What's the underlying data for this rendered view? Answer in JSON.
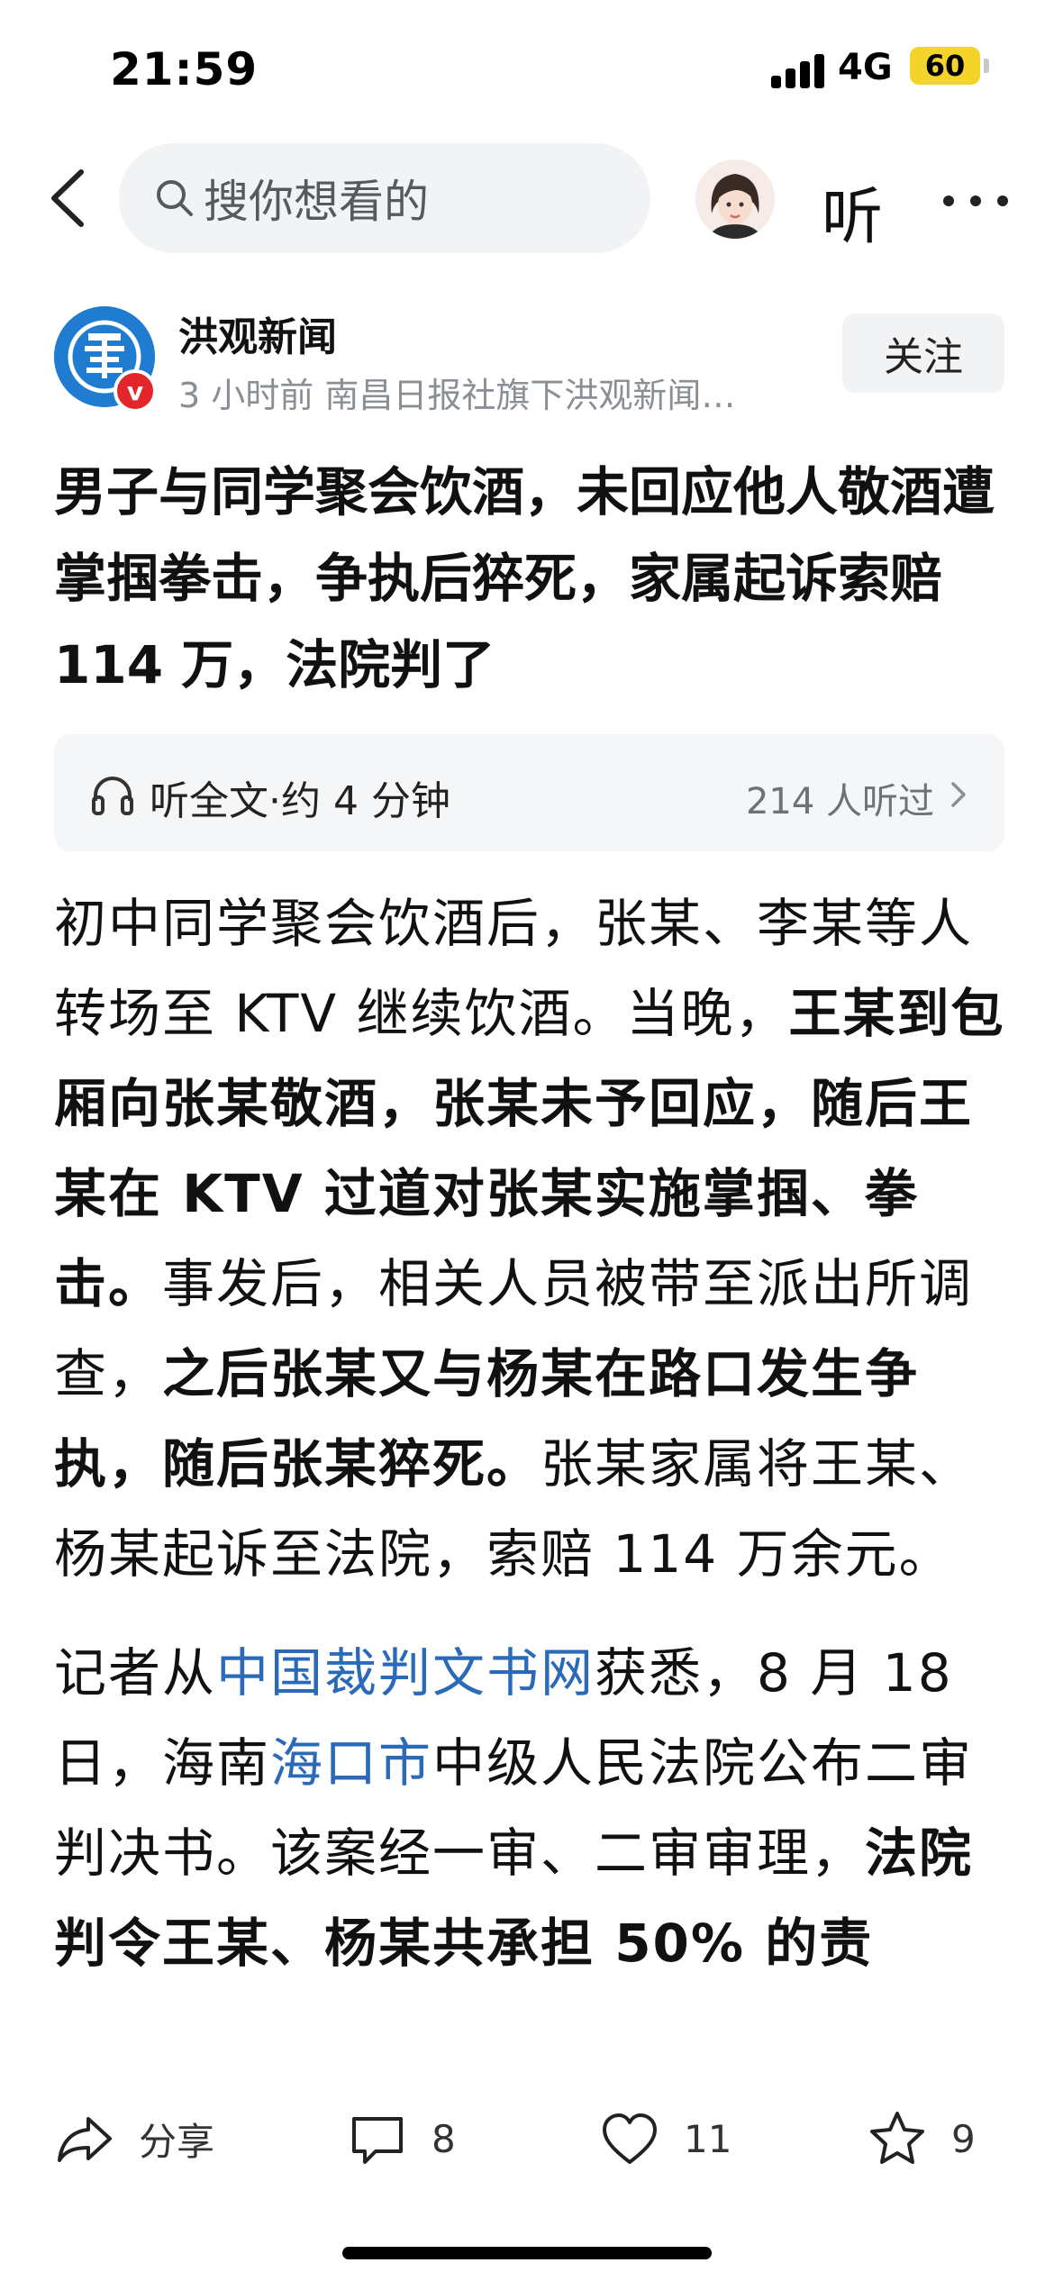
{
  "status_bar": {
    "time": "21:59",
    "network": "4G",
    "battery": "60"
  },
  "nav": {
    "search_placeholder": "搜你想看的",
    "listen_label": "听"
  },
  "author": {
    "name": "洪观新闻",
    "verified_mark": "v",
    "meta": "3 小时前   南昌日报社旗下洪观新闻…",
    "follow_label": "关注"
  },
  "article": {
    "title": "男子与同学聚会饮酒，未回应他人敬酒遭掌掴拳击，争执后猝死，家属起诉索赔 114 万，法院判了",
    "listen": {
      "label": "听全文·约 4 分钟",
      "count": "214 人听过"
    },
    "p1": {
      "s1": "初中同学聚会饮酒后，张某、李某等人转场至 KTV 继续饮酒。当晚，",
      "b1": "王某到包厢向张某敬酒，张某未予回应，随后王某在 KTV 过道对张某实施掌掴、拳击。",
      "s2": "事发后，相关人员被带至派出所调查，",
      "b2": "之后张某又与杨某在路口发生争执，随后张某猝死。",
      "s3": "张某家属将王某、杨某起诉至法院，索赔 114 万余元。"
    },
    "p2": {
      "s1": "记者从",
      "link1": "中国裁判文书网",
      "s2": "获悉，8 月 18 日，海南",
      "link2": "海口市",
      "s3": "中级人民法院公布二审判决书。该案经一审、二审审理，",
      "b1": "法院判令王某、杨某共承担 50% 的责"
    }
  },
  "actions": {
    "share": "分享",
    "comments": "8",
    "likes": "11",
    "favorites": "9"
  },
  "colors": {
    "link": "#2a6ab8",
    "logo_blue": "#1f7cd1",
    "badge_red": "#e3262a",
    "battery_yellow": "#f5d42a"
  }
}
